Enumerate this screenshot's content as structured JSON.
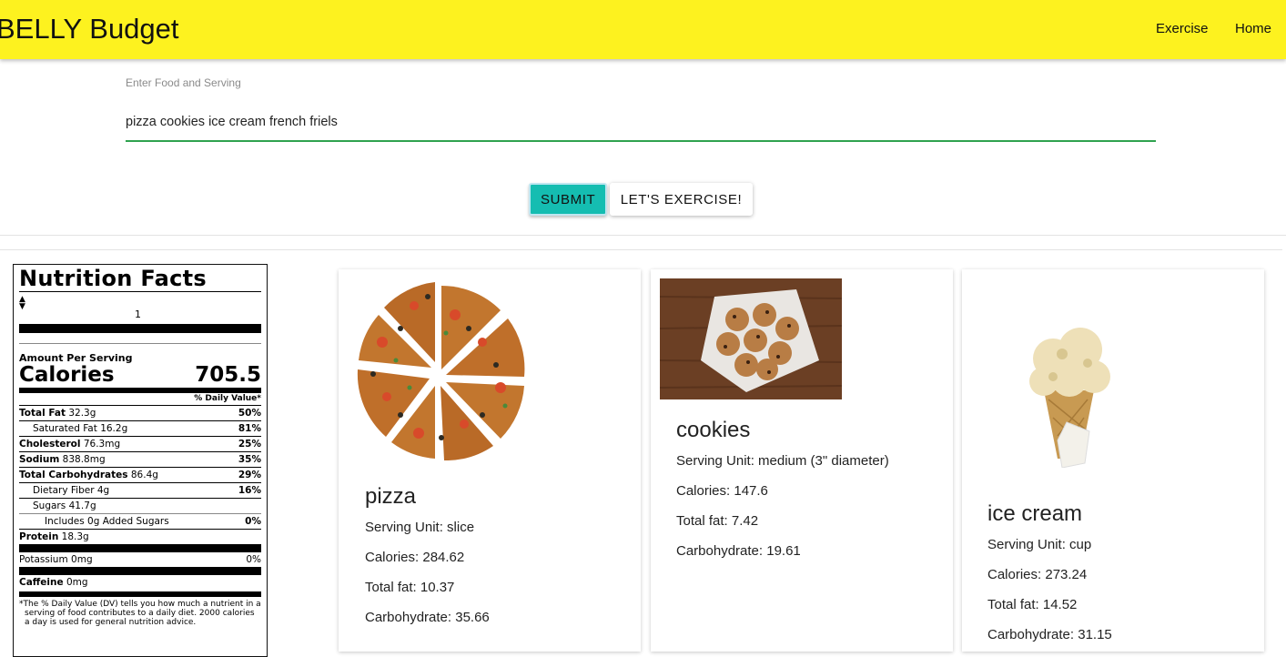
{
  "header": {
    "brand": "BELLY Budget",
    "nav": [
      {
        "label": "Exercise"
      },
      {
        "label": "Home"
      }
    ],
    "color": "#fdf21f"
  },
  "form": {
    "label": "Enter Food and Serving",
    "value": "pizza cookies ice cream french friels",
    "submit_label": "SUBMIT",
    "exercise_label": "LET'S EXERCISE!",
    "accent": "#15bdb1"
  },
  "nutrition": {
    "title": "Nutrition Facts",
    "serving_qty": "1",
    "amount_per_serving": "Amount Per Serving",
    "calories_label": "Calories",
    "calories": "705.5",
    "dv_header": "% Daily Value*",
    "rows": [
      {
        "name": "Total Fat",
        "amount": "32.3g",
        "dv": "50%"
      },
      {
        "name": "Saturated Fat",
        "amount": "16.2g",
        "dv": "81%"
      },
      {
        "name": "Cholesterol",
        "amount": "76.3mg",
        "dv": "25%"
      },
      {
        "name": "Sodium",
        "amount": "838.8mg",
        "dv": "35%"
      },
      {
        "name": "Total Carbohydrates",
        "amount": "86.4g",
        "dv": "29%"
      },
      {
        "name": "Dietary Fiber",
        "amount": "4g",
        "dv": "16%"
      },
      {
        "name": "Sugars",
        "amount": "41.7g"
      },
      {
        "name": "Includes 0g Added Sugars",
        "dv": "0%"
      },
      {
        "name": "Protein",
        "amount": "18.3g"
      },
      {
        "name": "Potassium",
        "amount": "0mg",
        "dv": "0%"
      },
      {
        "name": "Caffeine",
        "amount": "0mg"
      }
    ],
    "footnote": "*The % Daily Value (DV) tells you how much a nutrient in a serving of food contributes to a daily diet. 2000 calories a day is used for general nutrition advice."
  },
  "foods": [
    {
      "name": "pizza",
      "serving": "Serving Unit: slice",
      "calories": "Calories: 284.62",
      "fat": "Total fat: 10.37",
      "carbs": "Carbohydrate: 35.66",
      "image": "pizza-image"
    },
    {
      "name": "cookies",
      "serving": "Serving Unit: medium (3\" diameter)",
      "calories": "Calories: 147.6",
      "fat": "Total fat: 7.42",
      "carbs": "Carbohydrate: 19.61",
      "image": "cookies-image"
    },
    {
      "name": "ice cream",
      "serving": "Serving Unit: cup",
      "calories": "Calories: 273.24",
      "fat": "Total fat: 14.52",
      "carbs": "Carbohydrate: 31.15",
      "image": "ice-cream-image"
    }
  ]
}
